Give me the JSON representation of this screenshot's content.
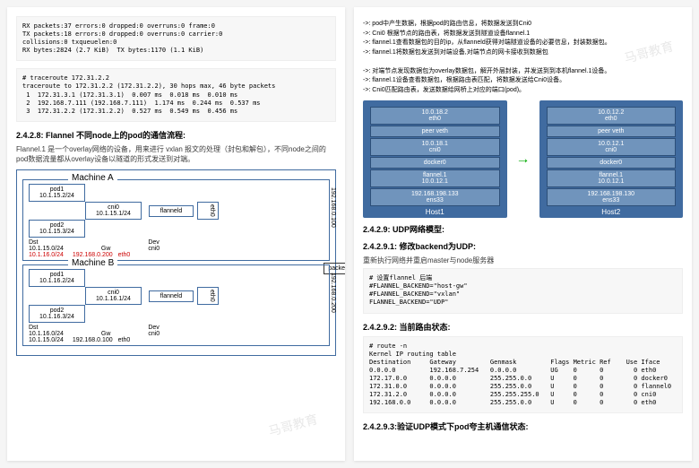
{
  "page1": {
    "code1": "RX packets:37 errors:0 dropped:0 overruns:0 frame:0\nTX packets:18 errors:0 dropped:0 overruns:0 carrier:0\ncollisions:0 txqueuelen:0\nRX bytes:2824 (2.7 KiB)  TX bytes:1170 (1.1 KiB)",
    "code2": "# traceroute 172.31.2.2\ntraceroute to 172.31.2.2 (172.31.2.2), 30 hops max, 46 byte packets\n 1  172.31.3.1 (172.31.3.1)  0.007 ms  0.018 ms  0.010 ms\n 2  192.168.7.111 (192.168.7.111)  1.174 ms  0.244 ms  0.537 ms\n 3  172.31.2.2 (172.31.2.2)  0.527 ms  0.549 ms  0.456 ms",
    "h1": "2.4.2.8: Flannel 不同node上的pod的通信流程:",
    "p1": "Flannel.1 是一个overlay网络的设备，用来进行 vxlan 报文的处理（封包和解包），不同node之间的pod数据流量都从overlay设备以隧道的形式发送到对端。",
    "mA": "Machine A",
    "mB": "Machine B",
    "pod1A": "pod1\n10.1.15.2/24",
    "pod2A": "pod2\n10.1.15.3/24",
    "cniA": "cni0\n10.1.15.1/24",
    "flA": "flanneld",
    "ethA": "eth0",
    "dstA": "Dst\n10.1.15.0/24",
    "gwA": "Gw",
    "devA": "Dev\ncni0",
    "dst2A": "10.1.16.0/24",
    "gw2A": "192.168.0.200",
    "dev2A": "eth0",
    "ipA": "192.168.0.100",
    "pod1B": "pod1\n10.1.16.2/24",
    "pod2B": "pod2\n10.1.16.3/24",
    "cniB": "cni0\n10.1.16.1/24",
    "flB": "flanneld",
    "ethB": "eth0",
    "dstB": "Dst\n10.1.16.0/24",
    "gwB": "Gw",
    "devB": "Dev\ncni0",
    "dst2B": "10.1.15.0/24",
    "gw2B": "192.168.0.100",
    "dev2B": "eth0",
    "ipB": "192.168.0.200",
    "packet": "packet"
  },
  "page2": {
    "bullets": "->: pod中产生数据，根据pod的路由信息，将数据发送到Cni0\n->: Cni0 根据节点的路由表，将数据发送到隧道设备flannel.1\n->: flannel.1查看数据包的目的ip，从flanneld获得对端隧道设备的必要信息，封装数据包。\n->: flannel.1将数据包发送到对端设备,对端节点的网卡接收到数据包\n\n->: 对端节点发现数据包为overlay数据包，解开外层封装，并发送到到本机flannel.1设备。\n->: flannel.1设备查看数据包，根据路由表匹配，将数据发送给Cni0设备。\n->: Cni0匹配路由表，发送数据给网桥上对应的端口(pod)。",
    "host1": {
      "eth": "10.0.18.2\neth0",
      "pv": "peer veth",
      "cni": "10.0.18.1\ncni0",
      "dk": "docker0",
      "fl": "flannel.1\n10.0.12.1",
      "ens": "192.168.198.133\nens33",
      "label": "Host1"
    },
    "host2": {
      "eth": "10.0.12.2\neth0",
      "pv": "peer veth",
      "cni": "10.0.12.1\ncni0",
      "dk": "docker0",
      "fl": "flannel.1\n10.0.12.1",
      "ens": "192.168.198.130\nens33",
      "label": "Host2"
    },
    "h1": "2.4.2.9: UDP网络模型:",
    "h2": "2.4.2.9.1: 修改backend为UDP:",
    "p1": "重新执行网络并重启master与node服务器",
    "code1": "# 设置flannel 后端\n#FLANNEL_BACKEND=\"host-gw\"\n#FLANNEL_BACKEND=\"vxlan\"\nFLANNEL_BACKEND=\"UDP\"",
    "h3": "2.4.2.9.2: 当前路由状态:",
    "code2": "# route -n\nKernel IP routing table\nDestination     Gateway         Genmask         Flags Metric Ref    Use Iface\n0.0.0.0         192.168.7.254   0.0.0.0         UG    0      0        0 eth0\n172.17.0.0      0.0.0.0         255.255.0.0     U     0      0        0 docker0\n172.31.0.0      0.0.0.0         255.255.0.0     U     0      0        0 flannel0\n172.31.2.0      0.0.0.0         255.255.255.0   U     0      0        0 cni0\n192.168.0.0     0.0.0.0         255.255.0.0     U     0      0        0 eth0",
    "h4": "2.4.2.9.3:验证UDP模式下pod夸主机通信状态:"
  }
}
